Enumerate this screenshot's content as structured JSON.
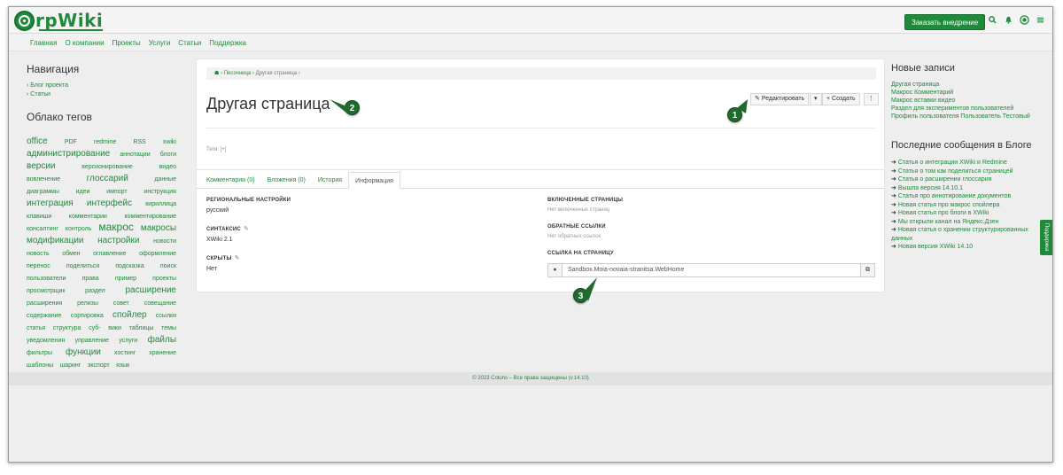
{
  "header": {
    "logo_text": "rpWiki",
    "cta_label": "Заказать внедрение",
    "icons": [
      "search-icon",
      "bell-icon",
      "globe-icon",
      "menu-icon"
    ]
  },
  "nav": {
    "items": [
      "Главная",
      "О компании",
      "Проекты",
      "Услуги",
      "Статьи",
      "Поддержка"
    ]
  },
  "sidebar": {
    "nav_title": "Навигация",
    "nav_links": [
      "› Блог проекта",
      "› Статьи"
    ],
    "tags_title": "Облако тегов",
    "tags": [
      {
        "t": "office",
        "s": 3
      },
      {
        "t": "PDF",
        "s": 1
      },
      {
        "t": "redmine",
        "s": 1
      },
      {
        "t": "RSS",
        "s": 1
      },
      {
        "t": "xwiki",
        "s": 1
      },
      {
        "t": "администрирование",
        "s": 3
      },
      {
        "t": "аннотации",
        "s": 1
      },
      {
        "t": "блоги",
        "s": 1
      },
      {
        "t": "версии",
        "s": 3
      },
      {
        "t": "версионирование",
        "s": 1
      },
      {
        "t": "видео",
        "s": 1
      },
      {
        "t": "вовлечение",
        "s": 1
      },
      {
        "t": "глоссарий",
        "s": 3
      },
      {
        "t": "данные",
        "s": 1
      },
      {
        "t": "диаграммы",
        "s": 1
      },
      {
        "t": "идеи",
        "s": 1
      },
      {
        "t": "импорт",
        "s": 1
      },
      {
        "t": "инструкция",
        "s": 1
      },
      {
        "t": "интеграция",
        "s": 3
      },
      {
        "t": "интерфейс",
        "s": 3
      },
      {
        "t": "кириллица",
        "s": 1
      },
      {
        "t": "клавиши",
        "s": 1
      },
      {
        "t": "комментарии",
        "s": 1
      },
      {
        "t": "комментирование",
        "s": 1
      },
      {
        "t": "консалтинг",
        "s": 1
      },
      {
        "t": "контроль",
        "s": 1
      },
      {
        "t": "макрос",
        "s": 4
      },
      {
        "t": "макросы",
        "s": 3
      },
      {
        "t": "модификации",
        "s": 3
      },
      {
        "t": "настройки",
        "s": 3
      },
      {
        "t": "новости",
        "s": 1
      },
      {
        "t": "новость",
        "s": 1
      },
      {
        "t": "обмен",
        "s": 1
      },
      {
        "t": "оглавление",
        "s": 1
      },
      {
        "t": "оформление",
        "s": 1
      },
      {
        "t": "перенос",
        "s": 1
      },
      {
        "t": "поделиться",
        "s": 1
      },
      {
        "t": "подсказка",
        "s": 1
      },
      {
        "t": "поиск",
        "s": 1
      },
      {
        "t": "пользователи",
        "s": 1
      },
      {
        "t": "права",
        "s": 1
      },
      {
        "t": "пример",
        "s": 1
      },
      {
        "t": "проекты",
        "s": 1
      },
      {
        "t": "просмотрщик",
        "s": 1
      },
      {
        "t": "раздел",
        "s": 1
      },
      {
        "t": "расширение",
        "s": 3
      },
      {
        "t": "расширения",
        "s": 1
      },
      {
        "t": "релизы",
        "s": 1
      },
      {
        "t": "совет",
        "s": 1
      },
      {
        "t": "совещание",
        "s": 1
      },
      {
        "t": "содержание",
        "s": 1
      },
      {
        "t": "сортировка",
        "s": 1
      },
      {
        "t": "спойлер",
        "s": 3
      },
      {
        "t": "ссылки",
        "s": 1
      },
      {
        "t": "статья",
        "s": 1
      },
      {
        "t": "структура",
        "s": 1
      },
      {
        "t": "суб-",
        "s": 1
      },
      {
        "t": "вики",
        "s": 1
      },
      {
        "t": "таблицы",
        "s": 1
      },
      {
        "t": "темы",
        "s": 1
      },
      {
        "t": "уведомления",
        "s": 1
      },
      {
        "t": "управление",
        "s": 1
      },
      {
        "t": "услуги",
        "s": 1
      },
      {
        "t": "файлы",
        "s": 3
      },
      {
        "t": "фильтры",
        "s": 1
      },
      {
        "t": "функции",
        "s": 3
      },
      {
        "t": "хостинг",
        "s": 1
      },
      {
        "t": "хранение",
        "s": 1
      },
      {
        "t": "шаблоны",
        "s": 1
      },
      {
        "t": "шаринг",
        "s": 1
      },
      {
        "t": "экспорт",
        "s": 1
      },
      {
        "t": "язык",
        "s": 1
      }
    ]
  },
  "main": {
    "breadcrumb": {
      "home_sep": "›",
      "items": [
        "Песочница",
        "Другая страница"
      ]
    },
    "title": "Другая страница",
    "toolbar": {
      "edit": "Редактировать",
      "edit_caret": "▾",
      "create": "Создать",
      "more": "⋮"
    },
    "tags_label": "Теги: [+]",
    "tabs": [
      "Комментарии (0)",
      "Вложения (0)",
      "История",
      "Информация"
    ],
    "info": {
      "regional_label": "РЕГИОНАЛЬНЫЕ НАСТРОЙКИ",
      "regional_value": "русский",
      "syntax_label": "СИНТАКСИС",
      "syntax_value": "XWiki 2.1",
      "hidden_label": "СКРЫТЫ",
      "hidden_value": "Нет",
      "included_label": "ВКЛЮЧЕННЫЕ СТРАНИЦЫ",
      "included_value": "Нет включенных страниц",
      "backlinks_label": "ОБРАТНЫЕ ССЫЛКИ",
      "backlinks_value": "Нет обратных ссылок",
      "link_label": "ССЫЛКА НА СТРАНИЦУ",
      "link_value": "Sandbox.Moia-novaia-stranitsa.WebHome"
    }
  },
  "right": {
    "recent_title": "Новые записи",
    "recent": [
      "Другая страница",
      "Макрос Комментарий",
      "Макрос вставки видео",
      "Раздел для экспериментов пользователей",
      "Профиль пользователя Пользователь Тестовый"
    ],
    "blog_title": "Последние сообщения в Блоге",
    "blog": [
      "Статья о интеграции XWiki и Redmine",
      "Статья о том как поделиться страницей",
      "Статья о расширении глоссария",
      "Вышла версия 14.10.1",
      "Статья про аннотирование документов",
      "Новая статья про макрос спойлера",
      "Новая статья про блоги в XWiki",
      "Мы открыли канал на Яндекс.Дзен",
      "Новая статья о хранении структурированных данных",
      "Новая версия XWiki 14.10"
    ],
    "support_tab": "Поддержка"
  },
  "footer": {
    "text": "© 2023 Coluns – Все права защищены (v.14.10)"
  },
  "markers": [
    "1",
    "2",
    "3"
  ],
  "colors": {
    "brand": "#1f8a3a",
    "marker": "#1d6b2e"
  }
}
